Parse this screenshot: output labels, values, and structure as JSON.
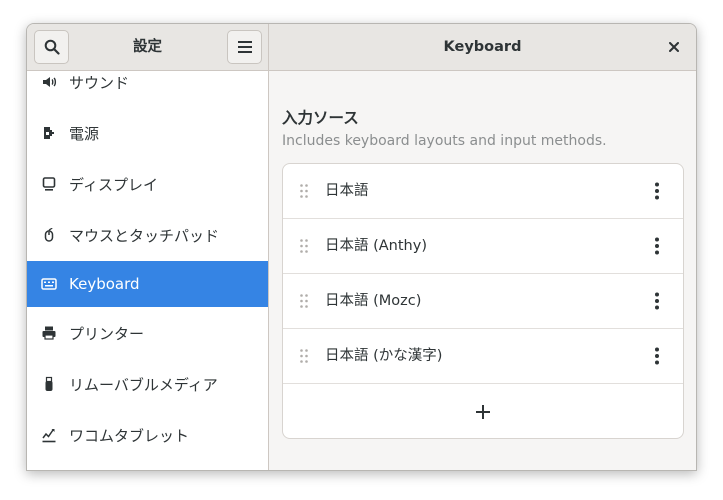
{
  "window": {
    "sidebar_title": "設定",
    "panel_title": "Keyboard"
  },
  "sidebar": {
    "items": [
      {
        "label": "サウンド",
        "icon": "speaker-icon",
        "active": false
      },
      {
        "label": "電源",
        "icon": "power-plug-icon",
        "active": false
      },
      {
        "label": "ディスプレイ",
        "icon": "display-icon",
        "active": false
      },
      {
        "label": "マウスとタッチパッド",
        "icon": "mouse-icon",
        "active": false
      },
      {
        "label": "Keyboard",
        "icon": "keyboard-icon",
        "active": true
      },
      {
        "label": "プリンター",
        "icon": "printer-icon",
        "active": false
      },
      {
        "label": "リムーバブルメディア",
        "icon": "usb-drive-icon",
        "active": false
      },
      {
        "label": "ワコムタブレット",
        "icon": "tablet-pen-icon",
        "active": false
      }
    ]
  },
  "input_sources": {
    "title": "入力ソース",
    "subtitle": "Includes keyboard layouts and input methods.",
    "items": [
      {
        "label": "日本語"
      },
      {
        "label": "日本語 (Anthy)"
      },
      {
        "label": "日本語 (Mozc)"
      },
      {
        "label": "日本語 (かな漢字)"
      }
    ],
    "add_icon": "plus-icon"
  },
  "colors": {
    "accent": "#3584e4",
    "headerbar": "#e8e6e3",
    "background": "#f6f5f4"
  }
}
